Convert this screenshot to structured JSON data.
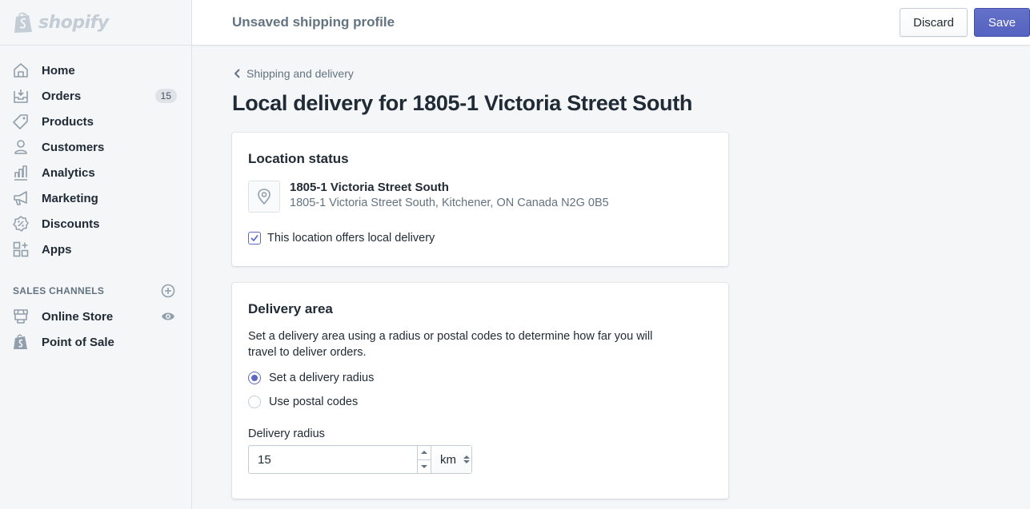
{
  "brand": {
    "name": "shopify",
    "accent_color": "#5c6ac4"
  },
  "topbar": {
    "title": "Unsaved shipping profile",
    "discard_label": "Discard",
    "save_label": "Save"
  },
  "sidebar": {
    "items": [
      {
        "label": "Home",
        "icon": "home-icon"
      },
      {
        "label": "Orders",
        "icon": "orders-icon",
        "badge": "15"
      },
      {
        "label": "Products",
        "icon": "tag-icon"
      },
      {
        "label": "Customers",
        "icon": "person-icon"
      },
      {
        "label": "Analytics",
        "icon": "bar-chart-icon"
      },
      {
        "label": "Marketing",
        "icon": "megaphone-icon"
      },
      {
        "label": "Discounts",
        "icon": "discount-icon"
      },
      {
        "label": "Apps",
        "icon": "apps-icon"
      }
    ],
    "sales_channels": {
      "title": "SALES CHANNELS",
      "add_icon": "plus-circle-icon",
      "items": [
        {
          "label": "Online Store",
          "icon": "store-icon",
          "action_icon": "eye-icon"
        },
        {
          "label": "Point of Sale",
          "icon": "shopify-bag-icon"
        }
      ]
    }
  },
  "main": {
    "breadcrumb": "Shipping and delivery",
    "page_title": "Local delivery for 1805-1 Victoria Street South",
    "location_card": {
      "title": "Location status",
      "location_name": "1805-1 Victoria Street South",
      "location_address": "1805-1 Victoria Street South, Kitchener, ON Canada N2G 0B5",
      "local_delivery_label": "This location offers local delivery",
      "local_delivery_checked": true
    },
    "delivery_card": {
      "title": "Delivery area",
      "description": "Set a delivery area using a radius or postal codes to determine how far you will travel to deliver orders.",
      "options": [
        {
          "label": "Set a delivery radius",
          "selected": true
        },
        {
          "label": "Use postal codes",
          "selected": false
        }
      ],
      "radius_label": "Delivery radius",
      "radius_value": "15",
      "unit_value": "km"
    }
  }
}
